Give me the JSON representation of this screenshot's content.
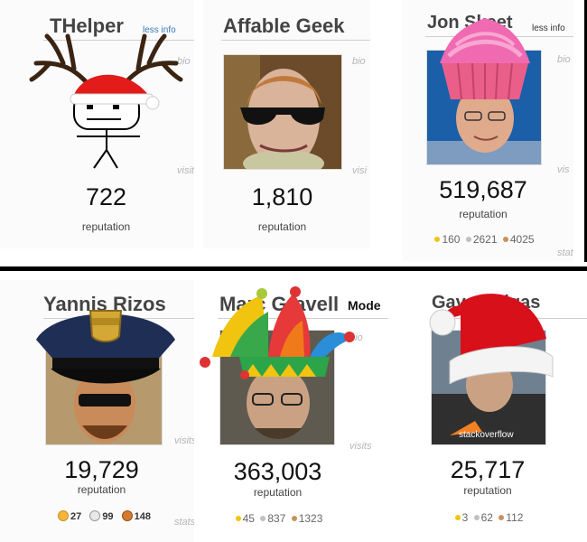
{
  "cards": [
    {
      "name": "THelper",
      "info_link": "less info",
      "side_labels": [
        "bio",
        "visit"
      ],
      "reputation": "722",
      "reputation_label": "reputation"
    },
    {
      "name": "Affable Geek",
      "side_labels": [
        "bio",
        "visi"
      ],
      "reputation": "1,810",
      "reputation_label": "reputation"
    },
    {
      "name": "Jon Skeet",
      "info_link": "less info",
      "side_labels": [
        "bio",
        "vis",
        "stat"
      ],
      "reputation": "519,687",
      "reputation_label": "reputation",
      "badges": {
        "gold": "160",
        "silver": "2621",
        "bronze": "4025"
      }
    },
    {
      "name": "Yannis Rizos",
      "side_labels": [
        "visits",
        "stats"
      ],
      "reputation": "19,729",
      "reputation_label": "reputation",
      "badges": {
        "gold": "27",
        "silver": "99",
        "bronze": "148"
      }
    },
    {
      "name": "Marc Gravell",
      "suffix": "Mode",
      "side_labels": [
        "bio",
        "visits"
      ],
      "reputation": "363,003",
      "reputation_label": "reputation",
      "badges": {
        "gold": "45",
        "silver": "837",
        "bronze": "1323"
      }
    },
    {
      "name": "Gaven Algas",
      "reputation": "25,717",
      "reputation_label": "reputation",
      "badges": {
        "gold": "3",
        "silver": "62",
        "bronze": "112"
      }
    }
  ],
  "colors": {
    "gold": "#f1c40f",
    "silver": "#c0c0c0",
    "bronze": "#c9915b",
    "link": "#3a77b5"
  }
}
